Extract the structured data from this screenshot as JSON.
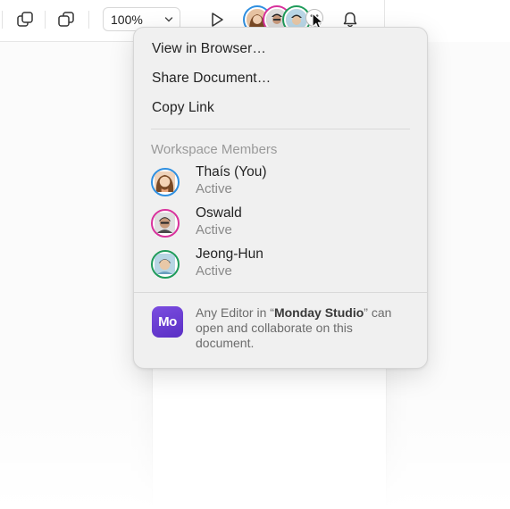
{
  "toolbar": {
    "zoom_value": "100%",
    "icons": [
      "duplicate-icon",
      "duplicate-alt-icon",
      "chevron-down-icon",
      "play-icon",
      "bell-icon"
    ],
    "collaborators": [
      {
        "name": "Thaís",
        "ring": "#2f8fe0"
      },
      {
        "name": "Oswald",
        "ring": "#d8319c"
      },
      {
        "name": "Jeong-Hun",
        "ring": "#1f9b5a"
      }
    ],
    "more_label": "• •"
  },
  "share_menu": {
    "items": [
      "View in Browser…",
      "Share Document…",
      "Copy Link"
    ],
    "members_header": "Workspace Members",
    "members": [
      {
        "name": "Thaís (You)",
        "status": "Active",
        "ring": "#2f8fe0"
      },
      {
        "name": "Oswald",
        "status": "Active",
        "ring": "#d8319c"
      },
      {
        "name": "Jeong-Hun",
        "status": "Active",
        "ring": "#1f9b5a"
      }
    ],
    "org": {
      "logo_text": "Mo",
      "prefix": "Any Editor in “",
      "name": "Monday Studio",
      "suffix": "” can open and collaborate on this document."
    }
  },
  "colors": {
    "accent_purple": "#6a3bd6",
    "ring_blue": "#2f8fe0",
    "ring_pink": "#d8319c",
    "ring_green": "#1f9b5a"
  }
}
